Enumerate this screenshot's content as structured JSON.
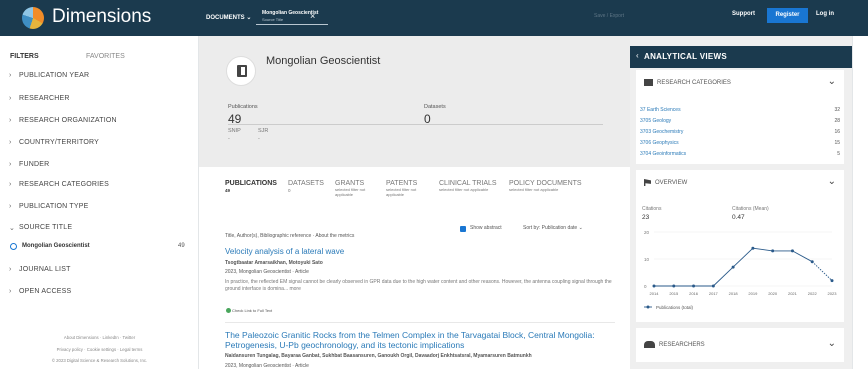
{
  "brand": "Dimensions",
  "header": {
    "documents": "DOCUMENTS ⌄",
    "tag_title": "Mongolian Geoscientist",
    "tag_sub": "Source Title",
    "save_export": "Save / Export",
    "support": "Support",
    "register": "Register",
    "login": "Log in"
  },
  "sidebar": {
    "filters": "FILTERS",
    "favorites": "FAVORITES",
    "items": [
      "PUBLICATION YEAR",
      "RESEARCHER",
      "RESEARCH ORGANIZATION",
      "COUNTRY/TERRITORY",
      "FUNDER",
      "RESEARCH CATEGORIES",
      "PUBLICATION TYPE",
      "SOURCE TITLE",
      "JOURNAL LIST",
      "OPEN ACCESS"
    ],
    "source_option": "Mongolian Geoscientist",
    "source_count": "49",
    "footer1": "About Dimensions · LinkedIn · Twitter",
    "footer2": "Privacy policy · Cookie settings · Legal terms",
    "footer3": "© 2023 Digital Science & Research Solutions, Inc."
  },
  "source": {
    "title": "Mongolian Geoscientist",
    "pubs_label": "Publications",
    "pubs": "49",
    "datasets_label": "Datasets",
    "datasets": "0",
    "snip": "SNIP",
    "sjr": "SJR",
    "snip_val": "-",
    "sjr_val": "-"
  },
  "tabs": [
    {
      "label": "PUBLICATIONS",
      "n": "49",
      "note": ""
    },
    {
      "label": "DATASETS",
      "n": "0",
      "note": ""
    },
    {
      "label": "GRANTS",
      "n": "",
      "note": "selected filter not applicable"
    },
    {
      "label": "PATENTS",
      "n": "",
      "note": "selected filter not applicable"
    },
    {
      "label": "CLINICAL TRIALS",
      "n": "",
      "note": "selected filter not applicable"
    },
    {
      "label": "POLICY DOCUMENTS",
      "n": "",
      "note": "selected filter not applicable"
    }
  ],
  "results": {
    "show_abstract": "Show abstract",
    "sort": "Sort by: Publication date ⌄",
    "ref_note": "Title, Author(s), Bibliographic reference · About the metrics",
    "items": [
      {
        "title": "Velocity analysis of a lateral wave",
        "authors": "Tsogtbaatar Amarsaikhan, Motoyuki Sato",
        "meta": "2023, Mongolian Geoscientist · Article",
        "abstract": "In practice, the reflected EM signal cannot be clearly observed in GPR data due to the high water content and other reasons. However, the antenna coupling signal through the ground interface is domina... more",
        "full_text": "Check  Link to Full Text"
      },
      {
        "title": "The Paleozoic Granitic Rocks from the Telmen Complex in the Tarvagatai Block, Central Mongolia: Petrogenesis, U-Pb geochronology, and its tectonic implications",
        "authors": "Naidansuren Tungalag, Bayaraa Ganbat, Sukhbat Baasansuren, Ganoukh Orgil, Davaadorj Enkhtsatsral, Myamarsuren Batmunkh",
        "meta": "2023, Mongolian Geoscientist · Article"
      }
    ]
  },
  "analytics": {
    "title": "ANALYTICAL VIEWS",
    "back": "‹",
    "cat_head": "RESEARCH CATEGORIES",
    "categories": [
      {
        "name": "37 Earth Sciences",
        "count": "32"
      },
      {
        "name": "3705 Geology",
        "count": "28"
      },
      {
        "name": "3703 Geochemistry",
        "count": "16"
      },
      {
        "name": "3706 Geophysics",
        "count": "15"
      },
      {
        "name": "3704 Geoinformatics",
        "count": "5"
      }
    ],
    "overview_head": "OVERVIEW",
    "citations_label": "Citations",
    "citations": "23",
    "mean_label": "Citations (Mean)",
    "mean": "0.47",
    "researchers_head": "RESEARCHERS",
    "toggle": "⌄"
  },
  "chart_data": {
    "type": "line",
    "x": [
      "2014",
      "2015",
      "2016",
      "2017",
      "2018",
      "2019",
      "2020",
      "2021",
      "2022",
      "2023"
    ],
    "series": [
      {
        "name": "Publications (total)",
        "values": [
          0,
          0,
          0,
          0,
          7,
          14,
          13,
          13,
          9,
          2
        ]
      }
    ],
    "ylim": [
      0,
      20
    ],
    "yticks": [
      "20",
      "10",
      "0"
    ],
    "color": "#2a5a8a"
  }
}
